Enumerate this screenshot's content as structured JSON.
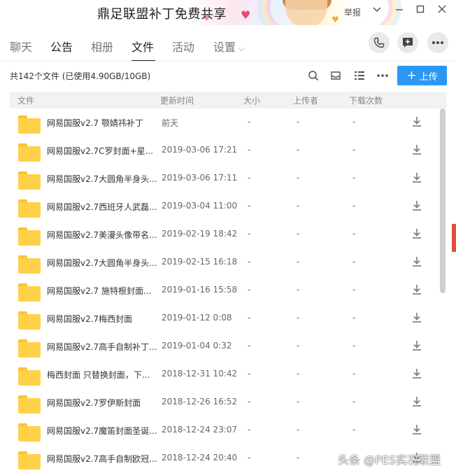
{
  "window": {
    "title": "鼎足联盟补丁免费共享",
    "report_label": "举报",
    "chevron_icon": "chevron-down-icon",
    "minimize_icon": "minimize-icon",
    "maximize_icon": "maximize-icon",
    "close_icon": "close-icon"
  },
  "nav": {
    "tabs": [
      {
        "label": "聊天",
        "active": false
      },
      {
        "label": "公告",
        "active": false
      },
      {
        "label": "相册",
        "active": false
      },
      {
        "label": "文件",
        "active": true
      },
      {
        "label": "活动",
        "active": false
      },
      {
        "label": "设置",
        "active": false
      }
    ],
    "actions": [
      "phone-icon",
      "add-chat-icon",
      "more-icon"
    ]
  },
  "toolbar": {
    "summary": "共142个文件 (已使用4.90GB/10GB)",
    "upload_label": "上传",
    "accent": "#2c97f5"
  },
  "table": {
    "headers": {
      "file": "文件",
      "time": "更新时间",
      "size": "大小",
      "uploader": "上传者",
      "downloads": "下载次数"
    },
    "rows": [
      {
        "name": "网易国服v2.7 颚婧祎补丁",
        "time": "前天",
        "size": "-",
        "uploader": "-",
        "downloads": "-"
      },
      {
        "name": "网易国服v2.7C罗封面+星...",
        "time": "2019-03-06 17:21",
        "size": "-",
        "uploader": "-",
        "downloads": "-"
      },
      {
        "name": "网易国服v2.7大圆角半身头...",
        "time": "2019-03-06 17:11",
        "size": "-",
        "uploader": "-",
        "downloads": "-"
      },
      {
        "name": "网易国服v2.7西班牙人武磊...",
        "time": "2019-03-04 11:00",
        "size": "-",
        "uploader": "-",
        "downloads": "-"
      },
      {
        "name": "网易国服v2.7美漫头像带名...",
        "time": "2019-02-19 18:42",
        "size": "-",
        "uploader": "-",
        "downloads": "-"
      },
      {
        "name": "网易国服v2.7大圆角半身头...",
        "time": "2019-02-15 16:18",
        "size": "-",
        "uploader": "-",
        "downloads": "-"
      },
      {
        "name": "网易国服v2.7 施特根封面...",
        "time": "2019-01-16 15:58",
        "size": "-",
        "uploader": "-",
        "downloads": "-"
      },
      {
        "name": "网易国服v2.7梅西封面",
        "time": "2019-01-12 0:08",
        "size": "-",
        "uploader": "-",
        "downloads": "-"
      },
      {
        "name": "网易国服v2.7高手自制补丁...",
        "time": "2019-01-04 0:32",
        "size": "-",
        "uploader": "-",
        "downloads": "-"
      },
      {
        "name": "梅西封面 只替换封面，下...",
        "time": "2018-12-31 10:42",
        "size": "-",
        "uploader": "-",
        "downloads": "-"
      },
      {
        "name": "网易国服v2.7罗伊斯封面",
        "time": "2018-12-26 16:52",
        "size": "-",
        "uploader": "-",
        "downloads": "-"
      },
      {
        "name": "网易国服v2.7魔笛封面圣诞...",
        "time": "2018-12-24 23:07",
        "size": "-",
        "uploader": "-",
        "downloads": "-"
      },
      {
        "name": "网易国服v2.7高手自制欧冠...",
        "time": "2018-12-24 20:40",
        "size": "-",
        "uploader": "-",
        "downloads": "-"
      }
    ]
  },
  "watermark": "头条 @PES实况联盟"
}
